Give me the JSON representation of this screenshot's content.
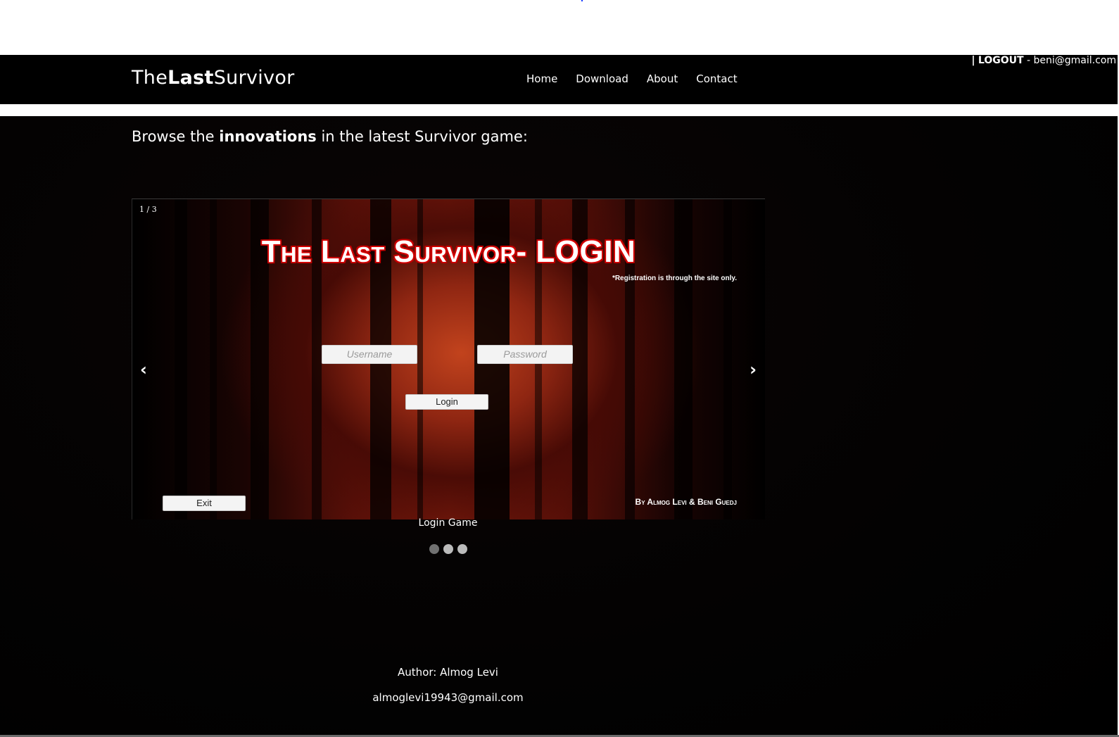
{
  "brand": {
    "prefix": "The",
    "bold": "Last",
    "suffix": "Survivor"
  },
  "nav": {
    "items": [
      {
        "label": "Home"
      },
      {
        "label": "Download"
      },
      {
        "label": "About"
      },
      {
        "label": "Contact"
      }
    ]
  },
  "user": {
    "separator": "|",
    "logout_label": "LOGOUT",
    "dash": " - ",
    "email": "beni@gmail.com"
  },
  "headline": {
    "prefix": "Browse the ",
    "bold": "innovations",
    "suffix": " in the latest Survivor game:"
  },
  "slideshow": {
    "slide_number": "1 / 3",
    "prev_label": "‹",
    "next_label": "›",
    "current_slide": {
      "title": "The Last Survivor- LOGIN",
      "registration_note": "*Registration is through the site only.",
      "username_placeholder": "Username",
      "password_placeholder": "Password",
      "login_button": "Login",
      "exit_button": "Exit",
      "credits": "By Almog Levi & Beni Guedj"
    },
    "caption": "Login Game",
    "dots": [
      {
        "active": true
      },
      {
        "active": false
      },
      {
        "active": false
      }
    ]
  },
  "footer": {
    "author": "Author: Almog Levi",
    "email": "almoglevi19943@gmail.com"
  },
  "colors": {
    "nav_bg": "#000000",
    "page_bg": "#000000",
    "text": "#ffffff",
    "dot_active": "#717171",
    "dot_inactive": "#bbbbbb",
    "title_outline": "#ff0000"
  }
}
